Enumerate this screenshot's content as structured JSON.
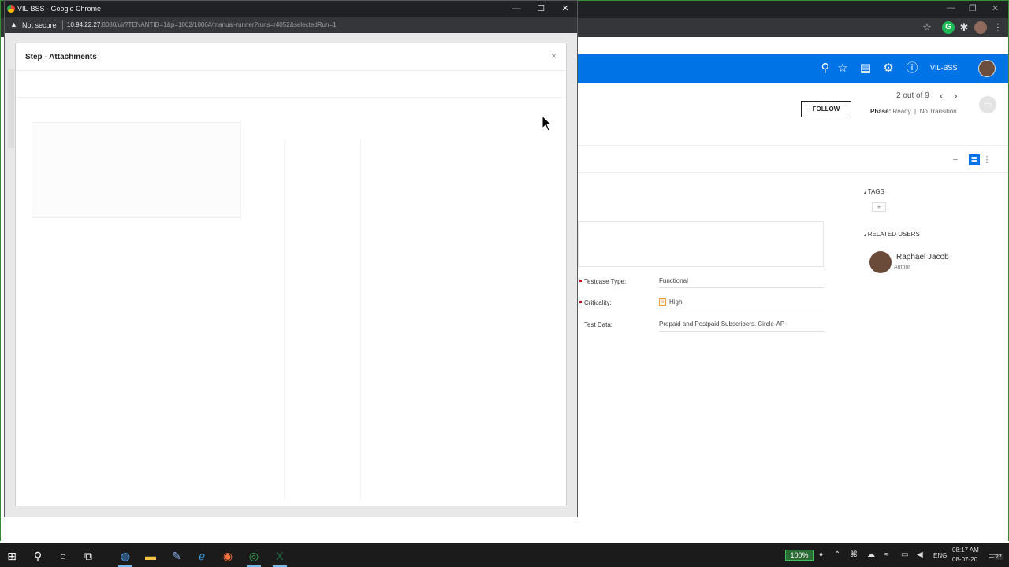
{
  "popup_window": {
    "title": "VIL-BSS - Google Chrome",
    "not_secure": "Not secure",
    "url_host": "10.94.22.27",
    "url_rest": ":8080/ui/?TENANTID=1&p=1002/1006#/manual-runner?runs=r4052&selectedRun=1"
  },
  "modal": {
    "title": "Step - Attachments",
    "close_icon": "×"
  },
  "app_header": {
    "tenant_label": "VIL-BSS",
    "icons": [
      "search-icon",
      "star-icon",
      "clipboard-icon",
      "gear-icon",
      "help-icon"
    ]
  },
  "entity": {
    "follow_label": "FOLLOW",
    "pager_text": "2 out of 9",
    "phase_label": "Phase:",
    "phase_value": "Ready",
    "transition": "No Transition"
  },
  "fields": [
    {
      "label": "Testcase Type:",
      "value": "Functional",
      "required": true
    },
    {
      "label": "Criticality:",
      "value": "High",
      "required": true,
      "badge": "3"
    },
    {
      "label": "Test Data:",
      "value": "Prepaid and Postpaid Subscribers. Circle-AP",
      "required": false
    }
  ],
  "sidebar": {
    "tags_title": "TAGS",
    "tags_add": "+",
    "related_users_title": "RELATED USERS",
    "users": [
      {
        "name": "Raphael Jacob",
        "role": "Author"
      }
    ]
  },
  "taskbar": {
    "zoom": "100%",
    "language": "ENG",
    "time": "08:17 AM",
    "date": "08-07-20",
    "notifications": "27"
  },
  "colors": {
    "brand_blue": "#0073e7",
    "required_red": "#d0021b",
    "zoom_green": "#3fbf5a"
  }
}
